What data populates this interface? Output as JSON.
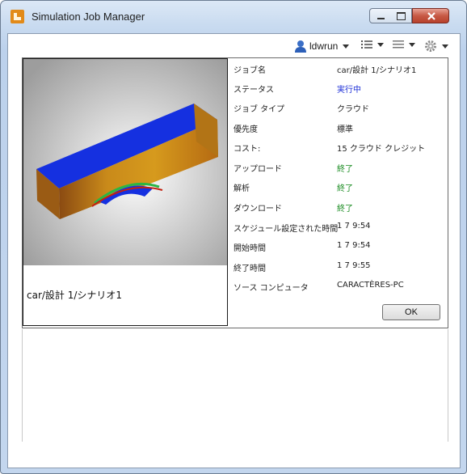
{
  "window": {
    "title": "Simulation Job Manager"
  },
  "toolbar": {
    "user": "ldwrun",
    "icons": [
      "user-icon",
      "list-view-icon",
      "menu-lines-icon",
      "gear-icon"
    ]
  },
  "job": {
    "caption": "car/設計 1/シナリオ1",
    "properties": [
      {
        "key": "ジョブ名",
        "value": "car/設計 1/シナリオ1",
        "color": "#1e1e1e"
      },
      {
        "key": "ステータス",
        "value": "実行中",
        "color": "#1b2dd6"
      },
      {
        "key": "ジョブ タイプ",
        "value": "クラウド",
        "color": "#1e1e1e"
      },
      {
        "key": "優先度",
        "value": "標準",
        "color": "#1e1e1e"
      },
      {
        "key": "コスト:",
        "value": "15 クラウド クレジット",
        "color": "#1e1e1e"
      },
      {
        "key": "アップロード",
        "value": "終了",
        "color": "#178a1f"
      },
      {
        "key": "解析",
        "value": "終了",
        "color": "#178a1f"
      },
      {
        "key": "ダウンロード",
        "value": "終了",
        "color": "#178a1f"
      },
      {
        "key": "スケジュール設定された時間",
        "value": "1 7 9:54",
        "color": "#1e1e1e"
      },
      {
        "key": "開始時間",
        "value": "1 7 9:54",
        "color": "#1e1e1e"
      },
      {
        "key": "終了時間",
        "value": "1 7 9:55",
        "color": "#1e1e1e"
      },
      {
        "key": "ソース コンピュータ",
        "value": "CARACTÈRES-PC",
        "color": "#1e1e1e"
      }
    ],
    "ok_label": "OK"
  }
}
